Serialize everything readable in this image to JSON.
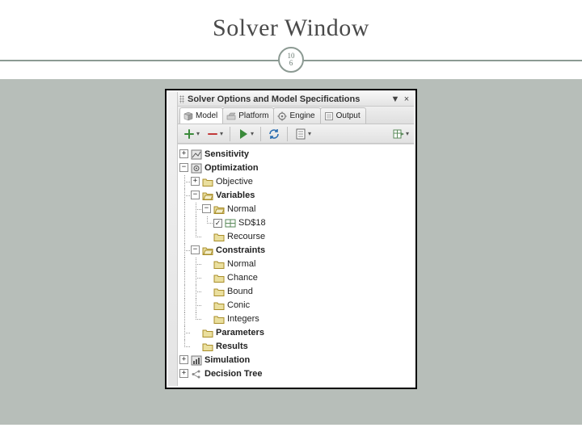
{
  "slide": {
    "title": "Solver Window",
    "page_top": "10",
    "page_bottom": "6"
  },
  "pane": {
    "header_title": "Solver Options and Model Specifications",
    "dropdown_glyph": "▼",
    "close_glyph": "×"
  },
  "tabs": [
    {
      "label": "Model",
      "iconName": "cube-icon"
    },
    {
      "label": "Platform",
      "iconName": "platform-icon"
    },
    {
      "label": "Engine",
      "iconName": "engine-icon"
    },
    {
      "label": "Output",
      "iconName": "output-icon"
    }
  ],
  "toolbar": {
    "add_glyph": "＋",
    "remove_glyph": "－",
    "play_color": "#3a8a3a",
    "refresh_color": "#2a6db0",
    "sheet_color": "#6a6a6a"
  },
  "tree": {
    "sensitivity": "Sensitivity",
    "optimization": "Optimization",
    "objective": "Objective",
    "variables": "Variables",
    "normal": "Normal",
    "cell": "SD$18",
    "recourse": "Recourse",
    "constraints": "Constraints",
    "normal2": "Normal",
    "chance": "Chance",
    "bound": "Bound",
    "conic": "Conic",
    "integers": "Integers",
    "parameters": "Parameters",
    "results": "Results",
    "simulation": "Simulation",
    "decision_tree": "Decision Tree"
  }
}
